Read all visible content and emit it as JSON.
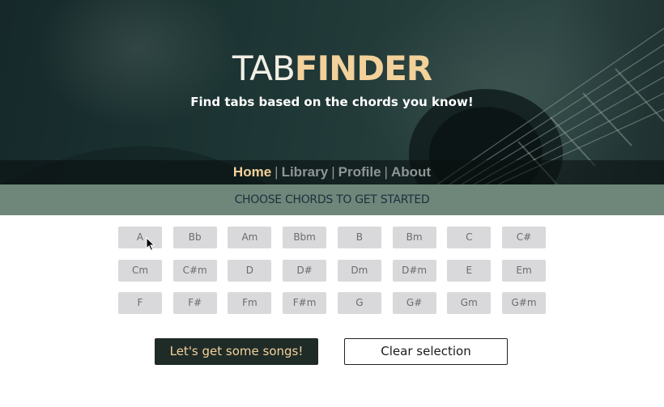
{
  "header": {
    "brand_part1": "TAB",
    "brand_part2": "FINDER",
    "tagline": "Find tabs based on the chords you know!"
  },
  "nav": {
    "items": [
      {
        "label": "Home",
        "active": true
      },
      {
        "label": "Library",
        "active": false
      },
      {
        "label": "Profile",
        "active": false
      },
      {
        "label": "About",
        "active": false
      }
    ],
    "separator": "|"
  },
  "banner": {
    "text": "CHOOSE CHORDS TO GET STARTED"
  },
  "chords": [
    [
      "A",
      "Bb",
      "Am",
      "Bbm",
      "B",
      "Bm",
      "C",
      "C#"
    ],
    [
      "Cm",
      "C#m",
      "D",
      "D#",
      "Dm",
      "D#m",
      "E",
      "Em"
    ],
    [
      "F",
      "F#",
      "Fm",
      "F#m",
      "G",
      "G#",
      "Gm",
      "G#m"
    ]
  ],
  "actions": {
    "primary_label": "Let's get some songs!",
    "secondary_label": "Clear selection"
  },
  "colors": {
    "accent": "#f3d19a",
    "banner_bg": "#6f877b",
    "chord_bg": "#d9d9db",
    "primary_button_bg": "#1f2b27"
  },
  "icons": {
    "cursor": "mouse-pointer-icon"
  }
}
